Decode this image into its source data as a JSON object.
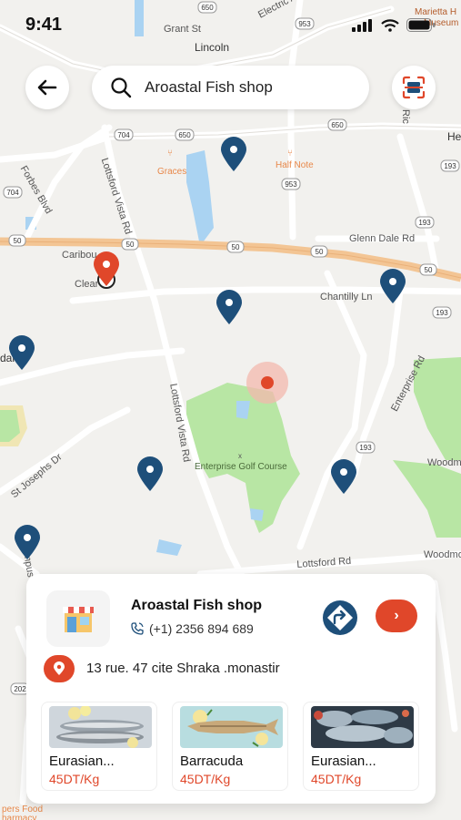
{
  "status_bar": {
    "time": "9:41"
  },
  "map": {
    "labels": {
      "lincoln": "Lincoln",
      "grant": "Grant St",
      "electric": "Electric Ave",
      "marietta": "Marietta H",
      "museum": "Museum",
      "forbes": "Forbes Blvd",
      "lottsford_vista": "Lottsford Vista Rd",
      "lottsford_vista_2": "Lottsford Vista Rd",
      "graces": "Graces",
      "half_note": "Half Note",
      "glenn_dale": "Glenn Dale Rd",
      "caribou": "Caribou",
      "clear": "Clear",
      "chantilly": "Chantilly Ln",
      "enterprise_rd": "Enterprise Rd",
      "enterprise_golf": "Enterprise Golf Course",
      "st_josephs": "St Josephs Dr",
      "lottsford_rd": "Lottsford Rd",
      "woodm": "Woodm",
      "woodmore": "Woodmor",
      "campus": "ampus",
      "ric": "Ric",
      "he": "He",
      "dale": "dale",
      "pers_food": "pers Food",
      "harmacy": "harmacy"
    },
    "routes": {
      "r953_a": "953",
      "r650_a": "650",
      "r704": "704",
      "r650_b": "650",
      "r193_a": "193",
      "r704_b": "704",
      "r953_b": "953",
      "r193_b": "193",
      "r50_a": "50",
      "r50_b": "50",
      "r50_c": "50",
      "r50_d": "50",
      "r50_e": "50",
      "r193_c": "193",
      "r193_d": "193",
      "r650_c": "650",
      "r202": "202"
    }
  },
  "search": {
    "value": "Aroastal Fish shop"
  },
  "icons": {
    "back": "arrow-left-icon",
    "search": "search-icon",
    "scan": "scan-icon",
    "phone": "phone-icon",
    "directions": "directions-icon",
    "go": "chevron-right-icon",
    "location": "location-pin-icon"
  },
  "colors": {
    "accent": "#e0472a",
    "pin_blue": "#1e4f7a",
    "park": "#b8e6a4",
    "water": "#aad3f2",
    "highway": "#f3c594"
  },
  "shop": {
    "name": "Aroastal Fish shop",
    "phone": "(+1) 2356 894 689",
    "address": "13 rue. 47 cite Shraka .monastir",
    "go_label": "›",
    "products": [
      {
        "name": "Eurasian...",
        "price": "45DT/Kg"
      },
      {
        "name": "Barracuda",
        "price": "45DT/Kg"
      },
      {
        "name": "Eurasian...",
        "price": "45DT/Kg"
      }
    ]
  }
}
